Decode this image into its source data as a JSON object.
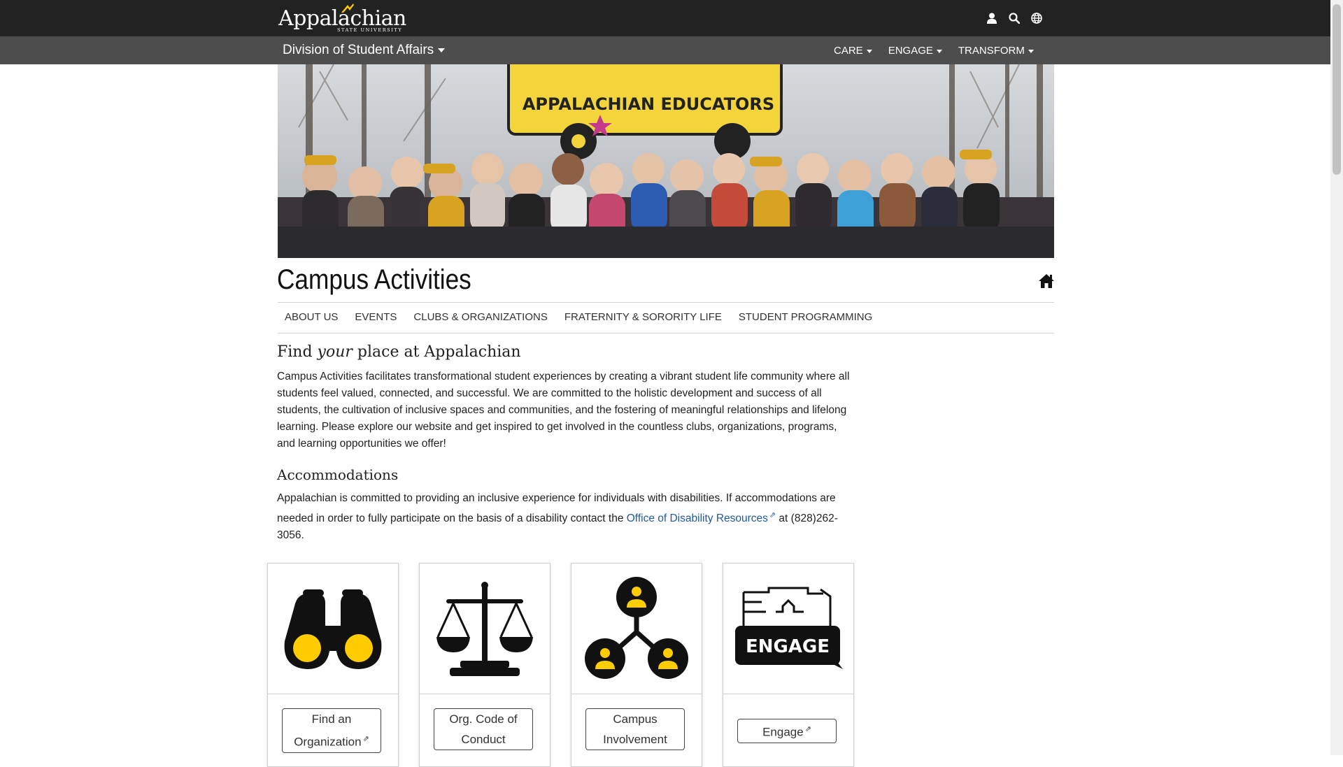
{
  "header": {
    "logo_text": "Appalachian",
    "logo_subtext": "STATE UNIVERSITY",
    "icons": [
      "user-icon",
      "search-icon",
      "globe-icon"
    ]
  },
  "subnav": {
    "division": "Division of Student Affairs",
    "pillars": [
      "CARE",
      "ENGAGE",
      "TRANSFORM"
    ]
  },
  "hero": {
    "banner_text": "APPALACHIAN EDUCATORS"
  },
  "page": {
    "title": "Campus Activities"
  },
  "section_nav": [
    "ABOUT US",
    "EVENTS",
    "CLUBS & ORGANIZATIONS",
    "FRATERNITY & SORORITY LIFE",
    "STUDENT PROGRAMMING"
  ],
  "intro": {
    "heading_pre": "Find ",
    "heading_em": "your",
    "heading_post": " place at Appalachian",
    "body": "Campus Activities facilitates transformational student experiences by creating a vibrant student life community where all students feel valued, connected, and successful.  We are committed to the holistic development and success of all students, the cultivation of inclusive spaces and communities, and the fostering of meaningful relationships and lifelong learning.  Please explore our website and get inspired to get involved in the countless clubs, organizations, programs, and learning opportunities we offer!"
  },
  "accommodations": {
    "heading": "Accommodations",
    "text_before": "Appalachian is committed to providing an inclusive experience for individuals with disabilities. If accommodations are needed in order to fully participate on the basis of a disability contact the ",
    "link_text": "Office of Disability Resources",
    "text_after": " at (828)262-3056."
  },
  "cards": [
    {
      "icon": "binoculars-icon",
      "line1": "Find an",
      "line2": "Organization",
      "external": true
    },
    {
      "icon": "scales-icon",
      "line1": "Org. Code of",
      "line2": "Conduct",
      "external": false
    },
    {
      "icon": "network-people-icon",
      "line1": "Campus",
      "line2": "Involvement",
      "external": false
    },
    {
      "icon": "engage-logo-icon",
      "line1": "Engage",
      "line2": "",
      "external": true,
      "logo_text": "ENGAGE"
    }
  ],
  "colors": {
    "topbar": "#222222",
    "subnav": "#4d4d4d",
    "app_gold": "#ffcc00",
    "link": "#1f5a9c"
  }
}
